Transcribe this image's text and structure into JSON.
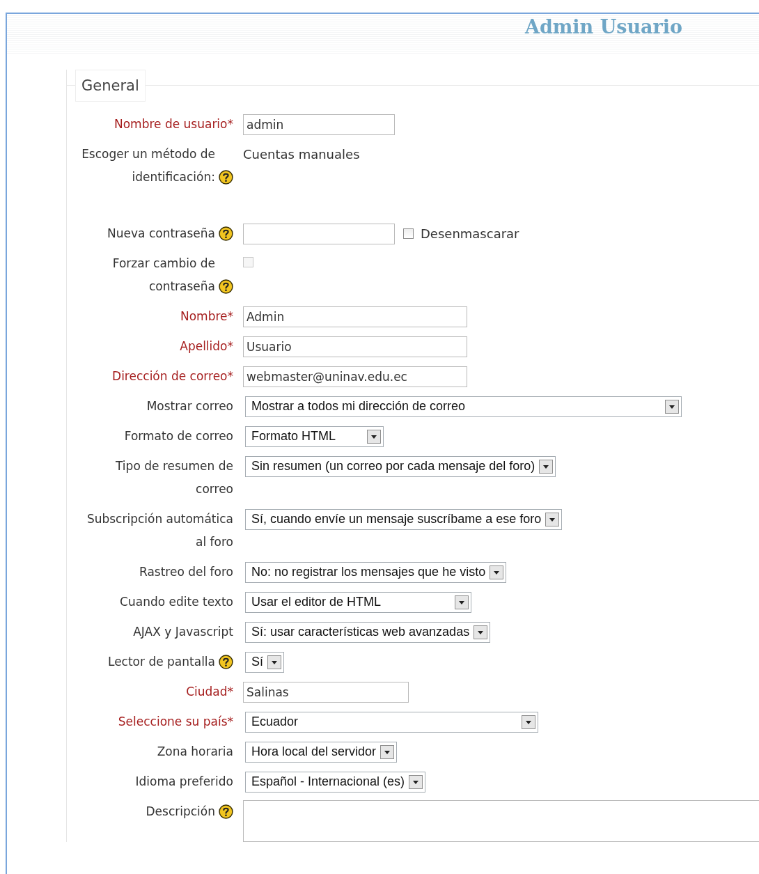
{
  "page": {
    "title": "Admin Usuario"
  },
  "fieldset": {
    "legend": "General"
  },
  "rows": [
    {
      "label": "Nombre de usuario*",
      "required": true,
      "help": false,
      "kind": "text",
      "value": "admin"
    },
    {
      "label": "Escoger un método de identificación:",
      "required": false,
      "help": true,
      "kind": "static",
      "value": "Cuentas manuales"
    },
    {
      "label": "Nueva contraseña",
      "required": false,
      "help": true,
      "kind": "password",
      "value": "",
      "option_label": "Desenmascarar",
      "checked": false
    },
    {
      "label": "Forzar cambio de contraseña",
      "required": false,
      "help": true,
      "kind": "checkbox",
      "checked": false,
      "disabled": true
    },
    {
      "label": "Nombre*",
      "required": true,
      "help": false,
      "kind": "text",
      "value": "Admin"
    },
    {
      "label": "Apellido*",
      "required": true,
      "help": false,
      "kind": "text",
      "value": "Usuario"
    },
    {
      "label": "Dirección de correo*",
      "required": true,
      "help": false,
      "kind": "text",
      "value": "webmaster@uninav.edu.ec"
    },
    {
      "label": "Mostrar correo",
      "required": false,
      "help": false,
      "kind": "select",
      "value": "Mostrar a todos mi dirección de correo"
    },
    {
      "label": "Formato de correo",
      "required": false,
      "help": false,
      "kind": "select",
      "value": "Formato HTML"
    },
    {
      "label": "Tipo de resumen de correo",
      "required": false,
      "help": false,
      "kind": "select",
      "value": "Sin resumen (un correo por cada mensaje del foro)"
    },
    {
      "label": "Subscripción automática al foro",
      "required": false,
      "help": false,
      "kind": "select",
      "value": "Sí, cuando envíe un mensaje suscríbame a ese foro"
    },
    {
      "label": "Rastreo del foro",
      "required": false,
      "help": false,
      "kind": "select",
      "value": "No: no registrar los mensajes que he visto"
    },
    {
      "label": "Cuando edite texto",
      "required": false,
      "help": false,
      "kind": "select",
      "value": "Usar el editor de HTML"
    },
    {
      "label": "AJAX y Javascript",
      "required": false,
      "help": false,
      "kind": "select",
      "value": "Sí: usar características web avanzadas"
    },
    {
      "label": "Lector de pantalla",
      "required": false,
      "help": true,
      "kind": "select",
      "value": "Sí"
    },
    {
      "label": "Ciudad*",
      "required": true,
      "help": false,
      "kind": "text",
      "value": "Salinas"
    },
    {
      "label": "Seleccione su país*",
      "required": true,
      "help": false,
      "kind": "select",
      "value": "Ecuador"
    },
    {
      "label": "Zona horaria",
      "required": false,
      "help": false,
      "kind": "select",
      "value": "Hora local del servidor"
    },
    {
      "label": "Idioma preferido",
      "required": false,
      "help": false,
      "kind": "select",
      "value": "Español - Internacional (es)"
    },
    {
      "label": "Descripción",
      "required": false,
      "help": true,
      "kind": "textarea",
      "value": ""
    }
  ]
}
